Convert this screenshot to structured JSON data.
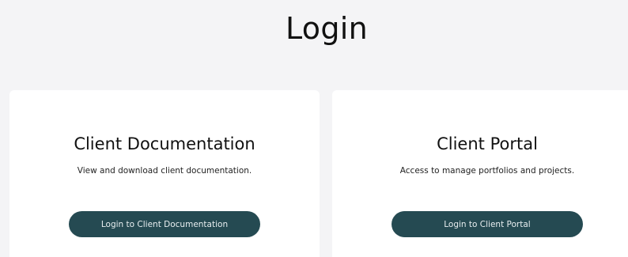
{
  "header": {
    "title": "Login"
  },
  "cards": [
    {
      "title": "Client Documentation",
      "description": "View and download client documentation.",
      "button_label": "Login to Client Documentation"
    },
    {
      "title": "Client Portal",
      "description": "Access to manage portfolios and projects.",
      "button_label": "Login to Client Portal"
    }
  ],
  "colors": {
    "page_background": "#f4f4f6",
    "card_background": "#ffffff",
    "button_background": "#254a52",
    "button_text": "#e8eef0"
  }
}
